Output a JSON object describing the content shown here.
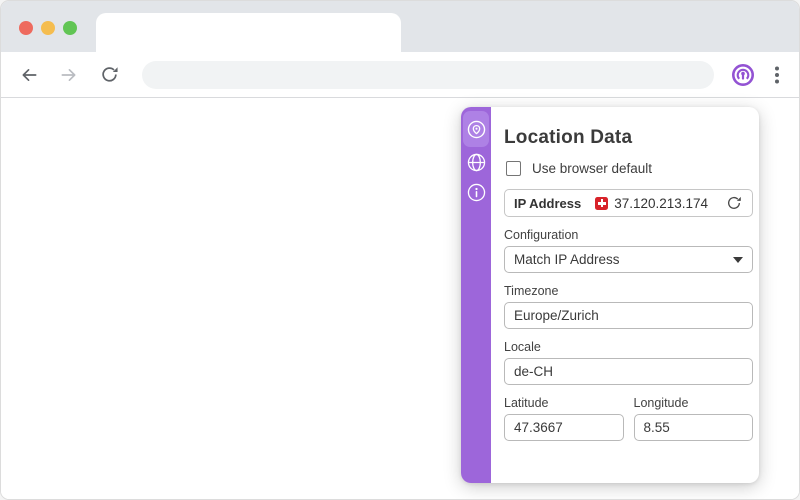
{
  "window": {
    "traffic_lights": [
      {
        "name": "close",
        "color": "#ee6a5e"
      },
      {
        "name": "minimize",
        "color": "#f5bd4f"
      },
      {
        "name": "maximize",
        "color": "#61c554"
      }
    ]
  },
  "toolbar": {
    "back_icon": "arrow-left-icon",
    "forward_icon": "arrow-right-icon",
    "reload_icon": "reload-icon",
    "address_value": "",
    "address_placeholder": "",
    "extension_icon": "vytal-extension-icon",
    "menu_icon": "kebab-menu-icon"
  },
  "popup": {
    "title": "Location Data",
    "checkbox": {
      "label": "Use browser default",
      "checked": false
    },
    "ip_row": {
      "label": "IP Address",
      "flag": "swiss-flag-icon",
      "value": "37.120.213.174",
      "refresh_icon": "refresh-icon"
    },
    "configuration": {
      "label": "Configuration",
      "value": "Match IP Address"
    },
    "timezone": {
      "label": "Timezone",
      "value": "Europe/Zurich"
    },
    "locale": {
      "label": "Locale",
      "value": "de-CH"
    },
    "latitude": {
      "label": "Latitude",
      "value": "47.3667"
    },
    "longitude": {
      "label": "Longitude",
      "value": "8.55"
    },
    "sidebar": [
      {
        "name": "location",
        "icon": "location-pin-circle-icon",
        "active": true
      },
      {
        "name": "browser",
        "icon": "globe-icon",
        "active": false
      },
      {
        "name": "info",
        "icon": "info-circle-icon",
        "active": false
      }
    ],
    "colors": {
      "accent": "#9d66da",
      "accent_active": "#ae81e5",
      "icon_purple": "#9353d3"
    }
  }
}
